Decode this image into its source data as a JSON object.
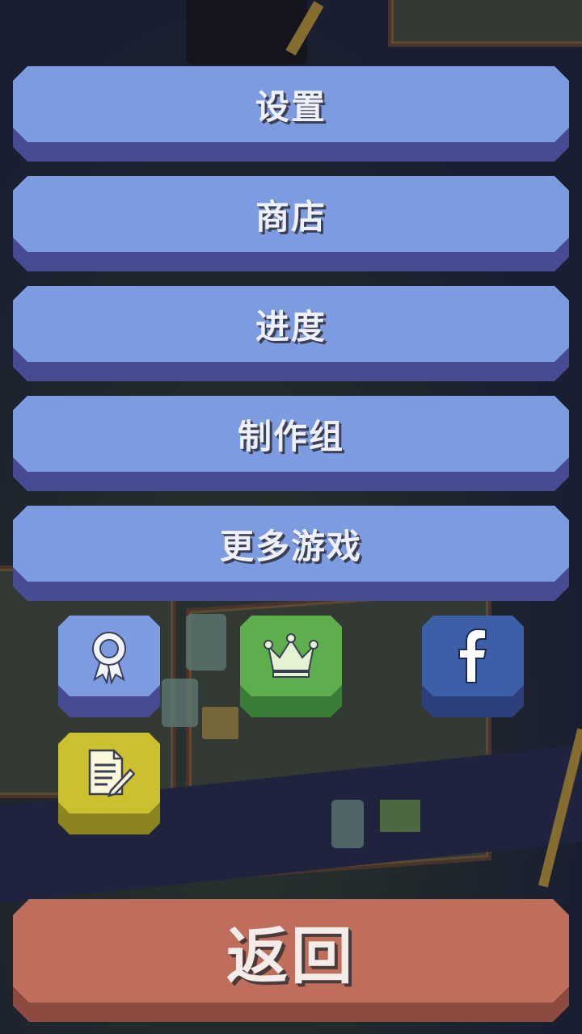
{
  "menu": {
    "items": [
      {
        "label": "设置"
      },
      {
        "label": "商店"
      },
      {
        "label": "进度"
      },
      {
        "label": "制作组"
      },
      {
        "label": "更多游戏"
      }
    ]
  },
  "icon_buttons": [
    {
      "icon": "ribbon-award-icon",
      "color": "#7c9be0"
    },
    {
      "icon": "crown-icon",
      "color": "#5fae4e"
    },
    {
      "icon": "facebook-icon",
      "color": "#3d5fa7"
    },
    {
      "icon": "notes-edit-icon",
      "color": "#cbc02e"
    }
  ],
  "back": {
    "label": "返回"
  },
  "colors": {
    "menu_face": "#7c9be0",
    "menu_base": "#464b93",
    "back_face": "#bf6e5b",
    "back_base": "#8c4a40"
  }
}
